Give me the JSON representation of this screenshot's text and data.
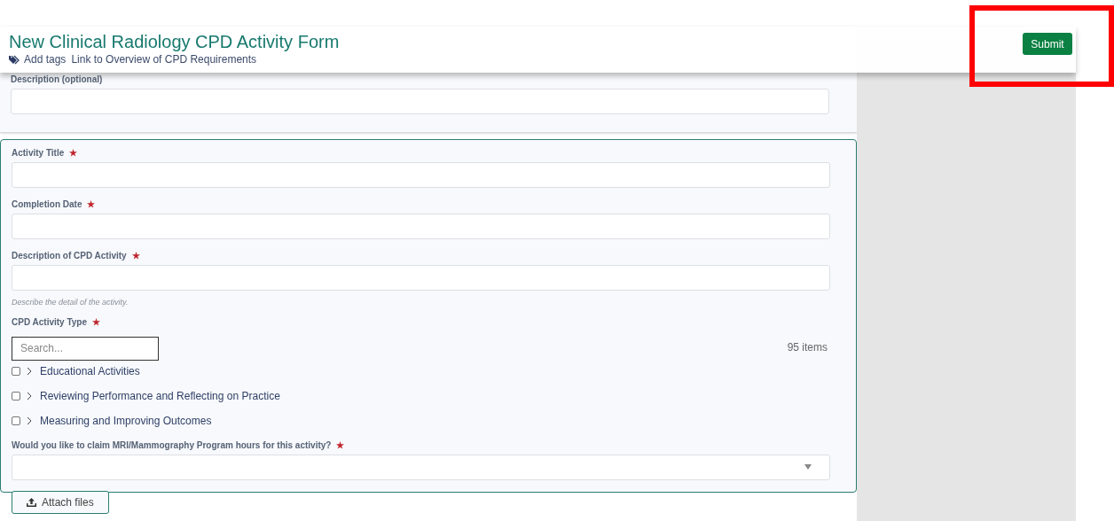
{
  "header": {
    "title": "New Clinical Radiology CPD Activity Form",
    "links": [
      {
        "kind": "tag",
        "label": "Add tags"
      },
      {
        "kind": "plain",
        "label": "Link to Overview of CPD Requirements"
      }
    ],
    "submit": "Submit"
  },
  "top_card": {
    "fields": [
      {
        "kind": "text",
        "label": "Description (optional)"
      }
    ]
  },
  "main_card": {
    "fields": [
      {
        "kind": "text",
        "label": "Activity Title",
        "required_mark": "★"
      },
      {
        "kind": "text",
        "label": "Completion Date",
        "required_mark": "★"
      },
      {
        "kind": "text",
        "label": "Description of CPD Activity",
        "required_mark": "★",
        "hint": "Describe the detail of the activity."
      },
      {
        "kind": "tree",
        "label": "CPD Activity Type",
        "required_mark": "★",
        "search": {
          "placeholder": "Search..."
        },
        "count": "95 items",
        "items": [
          {
            "label": "Educational Activities",
            "checked": false,
            "expanded": false
          },
          {
            "label": "Reviewing Performance and Reflecting on Practice",
            "checked": false,
            "expanded": false
          },
          {
            "label": "Measuring and Improving Outcomes",
            "checked": false,
            "expanded": false
          }
        ]
      },
      {
        "kind": "select",
        "label": "Would you like to claim MRI/Mammography Program hours for this activity?",
        "required_mark": "★"
      }
    ],
    "attach": "Attach files"
  },
  "highlight_frame": true
}
